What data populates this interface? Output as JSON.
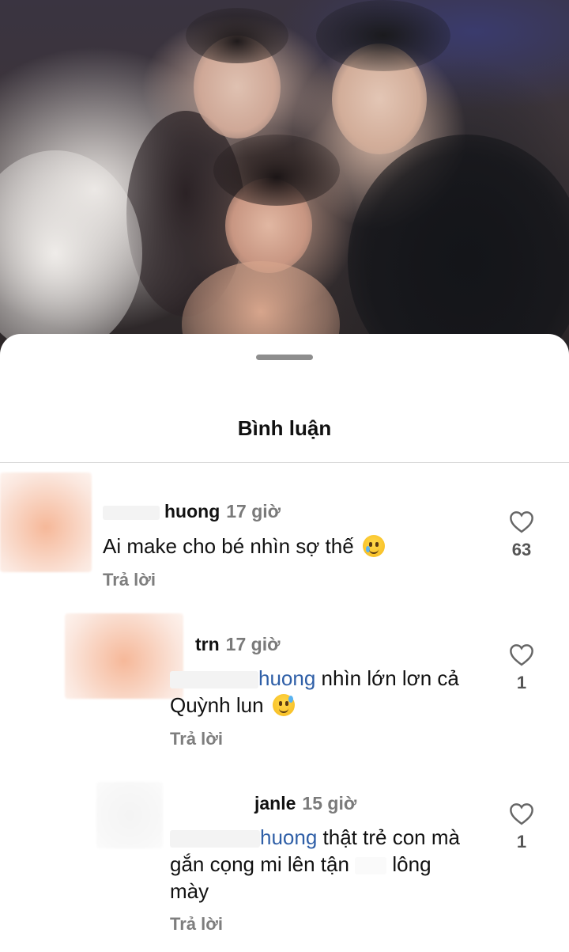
{
  "sheet": {
    "title": "Bình luận"
  },
  "comments": [
    {
      "username": "huong",
      "time": "17 giờ",
      "text": "Ai make cho bé nhìn sợ thế",
      "emoji": "crying-face-emoji",
      "reply_label": "Trả lời",
      "likes": "63"
    },
    {
      "username": "trn",
      "time": "17 giờ",
      "mention": "huong",
      "text_line1": " nhìn lớn lơn cả",
      "text_line2": "Quỳnh lun",
      "emoji": "sweat-smile-emoji",
      "reply_label": "Trả lời",
      "likes": "1"
    },
    {
      "username": "janle",
      "time": "15 giờ",
      "mention": "huong",
      "text_line1": " thật trẻ con mà",
      "text_line2a": "gắn cọng mi lên tận",
      "text_line2b": "lông",
      "text_line3": "mày",
      "reply_label": "Trả lời",
      "likes": "1"
    }
  ],
  "icons": {
    "like": "heart-outline-icon"
  },
  "colors": {
    "mention": "#2f5fa7",
    "muted": "#7a7a7a"
  }
}
